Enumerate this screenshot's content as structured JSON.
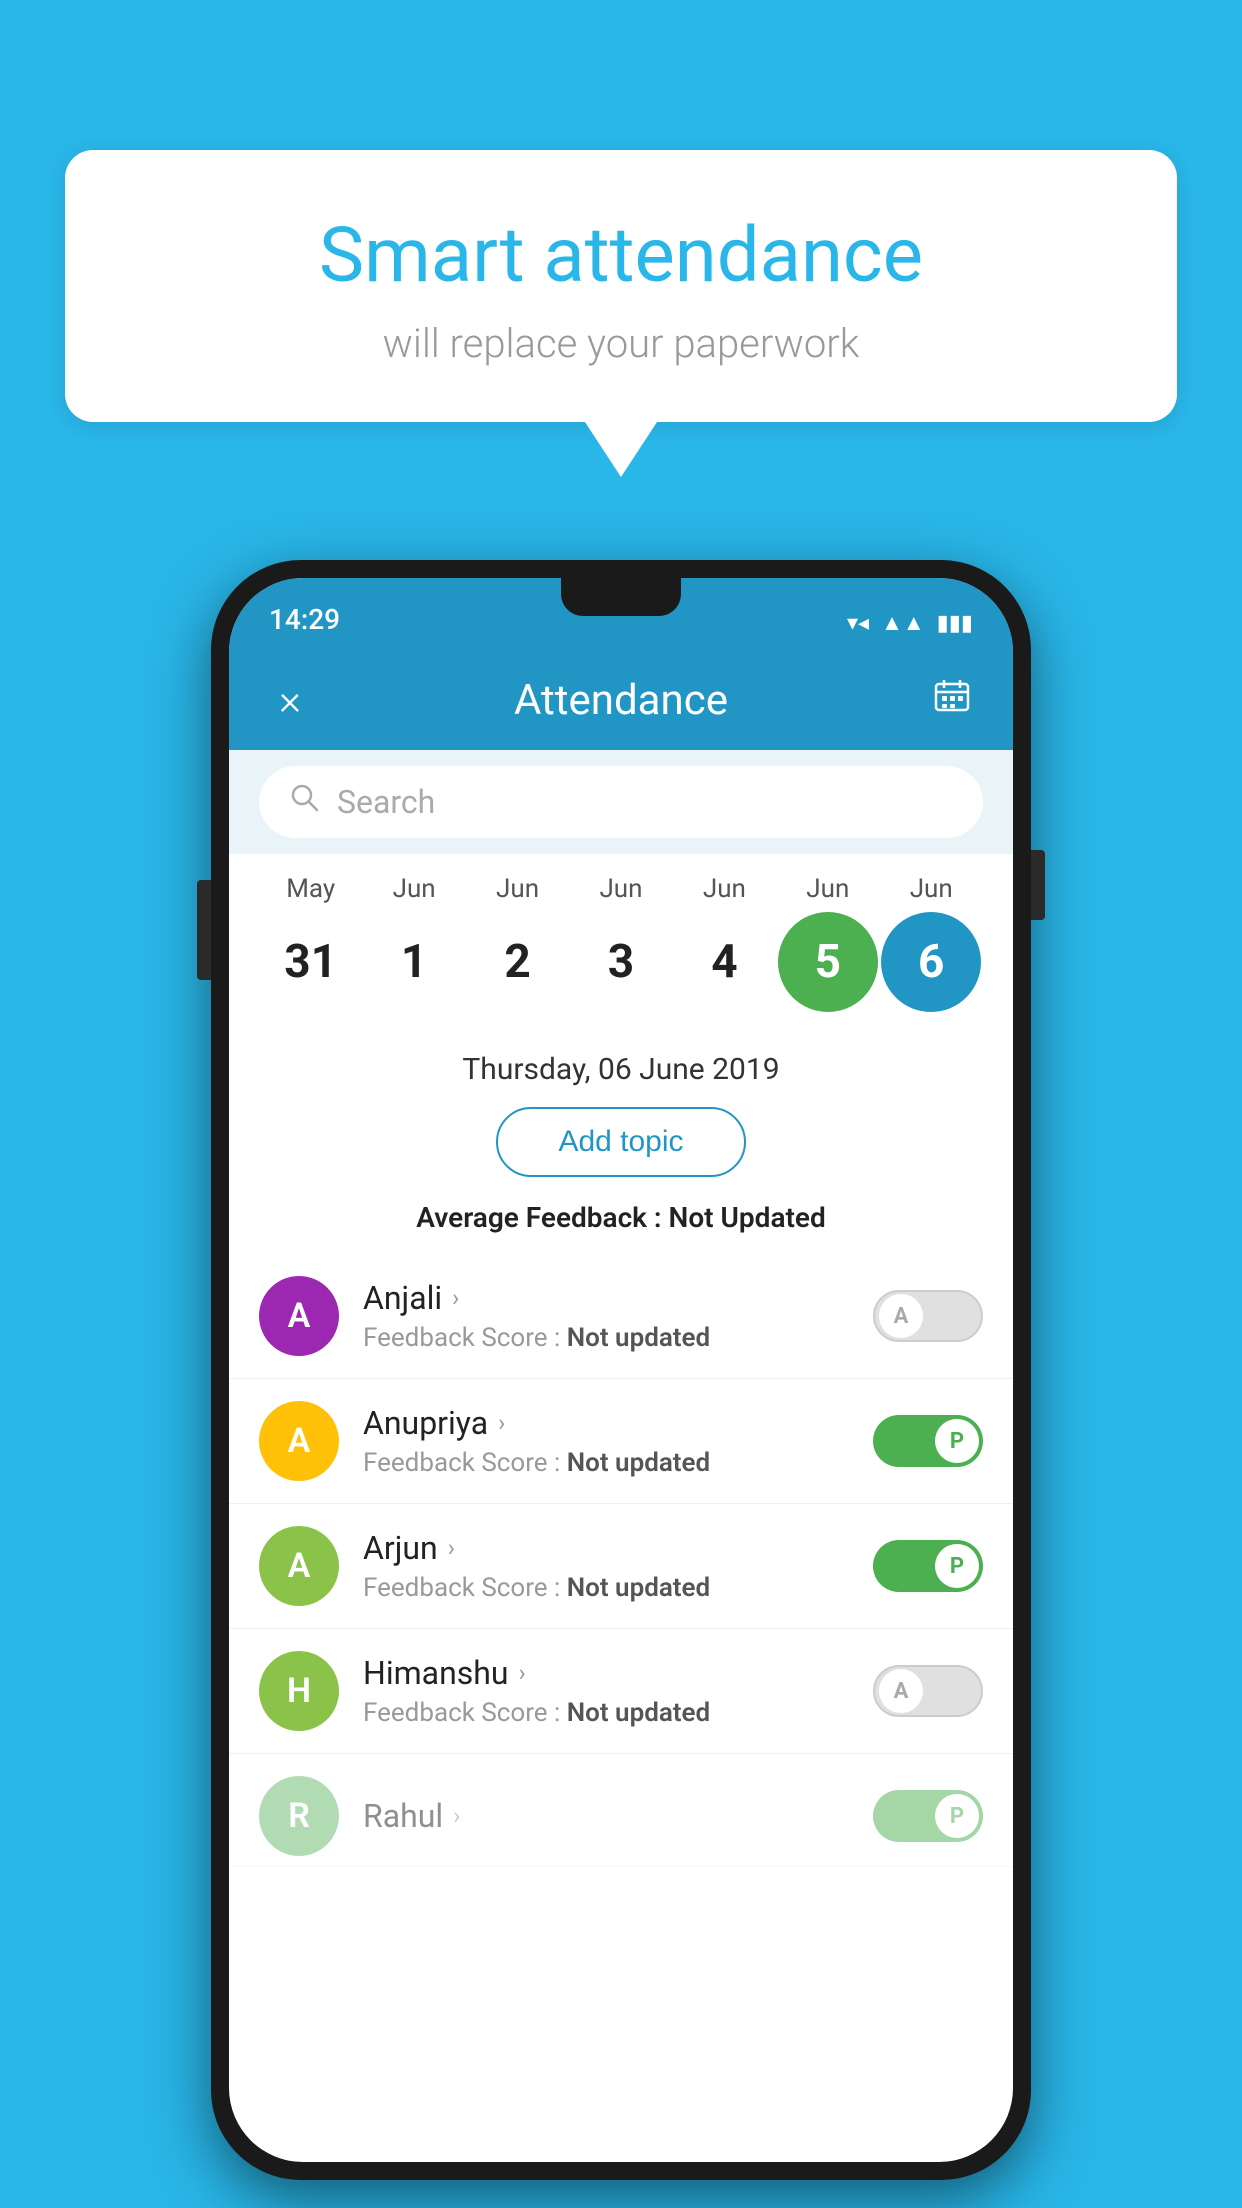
{
  "background_color": "#29b6e8",
  "speech_bubble": {
    "title": "Smart attendance",
    "subtitle": "will replace your paperwork"
  },
  "status_bar": {
    "time": "14:29",
    "icons": [
      "wifi",
      "signal",
      "battery"
    ]
  },
  "header": {
    "title": "Attendance",
    "close_label": "×",
    "calendar_icon": "📅"
  },
  "search": {
    "placeholder": "Search"
  },
  "calendar": {
    "months": [
      "May",
      "Jun",
      "Jun",
      "Jun",
      "Jun",
      "Jun",
      "Jun"
    ],
    "dates": [
      "31",
      "1",
      "2",
      "3",
      "4",
      "5",
      "6"
    ],
    "today_index": 5,
    "selected_index": 6
  },
  "selected_date_label": "Thursday, 06 June 2019",
  "add_topic_label": "Add topic",
  "avg_feedback_label": "Average Feedback : ",
  "avg_feedback_value": "Not Updated",
  "students": [
    {
      "name": "Anjali",
      "avatar_letter": "A",
      "avatar_color": "#9c27b0",
      "feedback_label": "Feedback Score : ",
      "feedback_value": "Not updated",
      "toggle_state": "off",
      "toggle_letter": "A"
    },
    {
      "name": "Anupriya",
      "avatar_letter": "A",
      "avatar_color": "#ffc107",
      "feedback_label": "Feedback Score : ",
      "feedback_value": "Not updated",
      "toggle_state": "on",
      "toggle_letter": "P"
    },
    {
      "name": "Arjun",
      "avatar_letter": "A",
      "avatar_color": "#8bc34a",
      "feedback_label": "Feedback Score : ",
      "feedback_value": "Not updated",
      "toggle_state": "on",
      "toggle_letter": "P"
    },
    {
      "name": "Himanshu",
      "avatar_letter": "H",
      "avatar_color": "#8bc34a",
      "feedback_label": "Feedback Score : ",
      "feedback_value": "Not updated",
      "toggle_state": "off",
      "toggle_letter": "A"
    }
  ]
}
